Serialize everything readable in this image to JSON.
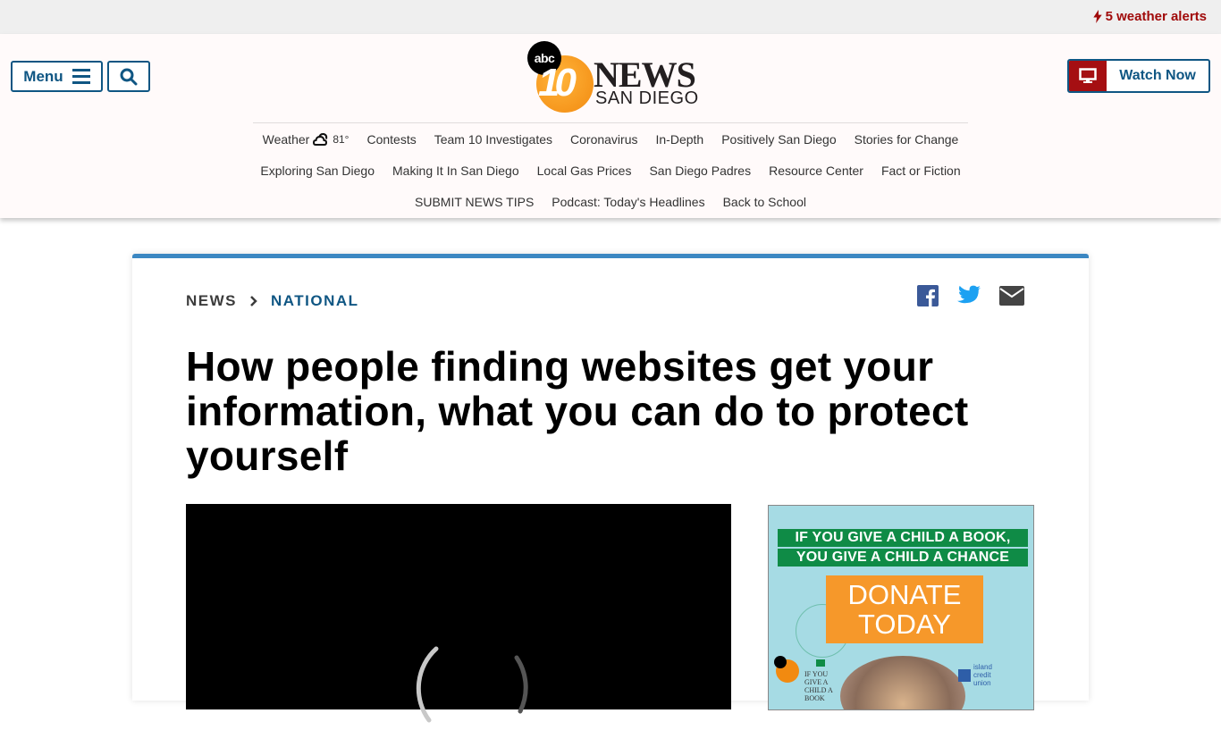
{
  "alert_bar": {
    "icon": "bolt-icon",
    "label": "5 weather alerts",
    "color": "#a00a0a"
  },
  "header": {
    "menu_label": "Menu",
    "search_icon": "search-icon",
    "logo": {
      "network": "abc",
      "channel": "10",
      "brand": "NEWS",
      "city": "SAN DIEGO"
    },
    "watch_now_label": "Watch Now",
    "brand_color": "#0f5683",
    "accent_red": "#a50f12"
  },
  "nav": {
    "weather": {
      "label": "Weather",
      "icon": "partly-cloudy-icon",
      "temp": "81°"
    },
    "row1": [
      "Contests",
      "Team 10 Investigates",
      "Coronavirus",
      "In-Depth",
      "Positively San Diego",
      "Stories for Change"
    ],
    "row2": [
      "Exploring San Diego",
      "Making It In San Diego",
      "Local Gas Prices",
      "San Diego Padres",
      "Resource Center",
      "Fact or Fiction"
    ],
    "row3": [
      "SUBMIT NEWS TIPS",
      "Podcast: Today's Headlines",
      "Back to School"
    ]
  },
  "article": {
    "breadcrumb": {
      "section": "NEWS",
      "subsection": "NATIONAL"
    },
    "share": [
      "facebook-icon",
      "twitter-icon",
      "email-icon"
    ],
    "headline": "How people finding websites get your information, what you can do to protect yourself",
    "accent_color": "#3b87c2"
  },
  "video": {
    "state": "loading"
  },
  "ad": {
    "line1": "IF YOU GIVE A CHILD A BOOK,",
    "line2": "YOU GIVE A CHILD A CHANCE",
    "donate_line1": "DONATE",
    "donate_line2": "TODAY",
    "sponsor_program": "IF YOU GIVE A CHILD A BOOK",
    "sponsor_bank": "island credit union"
  }
}
